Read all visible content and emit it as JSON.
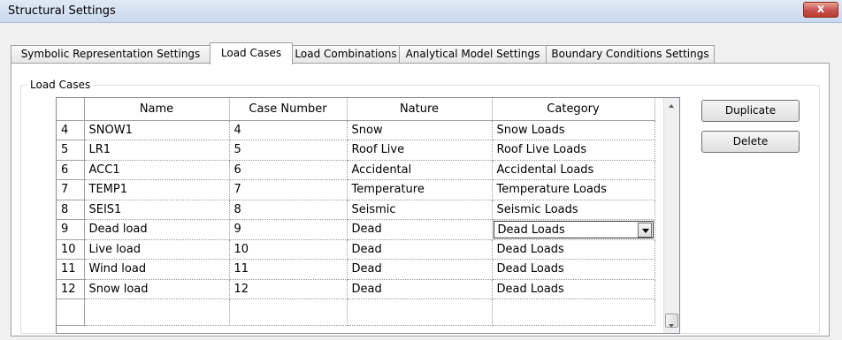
{
  "window": {
    "title": "Structural Settings",
    "close_glyph": "x"
  },
  "tabs": [
    {
      "label": "Symbolic Representation Settings",
      "active": false
    },
    {
      "label": "Load Cases",
      "active": true
    },
    {
      "label": "Load Combinations",
      "active": false
    },
    {
      "label": "Analytical Model Settings",
      "active": false
    },
    {
      "label": "Boundary Conditions Settings",
      "active": false
    }
  ],
  "load_cases": {
    "group_label": "Load Cases",
    "columns": [
      "Name",
      "Case Number",
      "Nature",
      "Category"
    ],
    "rows": [
      {
        "index": "4",
        "name": "SNOW1",
        "case_number": "4",
        "nature": "Snow",
        "category": "Snow Loads"
      },
      {
        "index": "5",
        "name": "LR1",
        "case_number": "5",
        "nature": "Roof Live",
        "category": "Roof Live Loads"
      },
      {
        "index": "6",
        "name": "ACC1",
        "case_number": "6",
        "nature": "Accidental",
        "category": "Accidental Loads"
      },
      {
        "index": "7",
        "name": "TEMP1",
        "case_number": "7",
        "nature": "Temperature",
        "category": "Temperature Loads"
      },
      {
        "index": "8",
        "name": "SEIS1",
        "case_number": "8",
        "nature": "Seismic",
        "category": "Seismic Loads"
      },
      {
        "index": "9",
        "name": "Dead load",
        "case_number": "9",
        "nature": "Dead",
        "category": "Dead Loads"
      },
      {
        "index": "10",
        "name": "Live load",
        "case_number": "10",
        "nature": "Dead",
        "category": "Dead Loads"
      },
      {
        "index": "11",
        "name": "Wind load",
        "case_number": "11",
        "nature": "Dead",
        "category": "Dead Loads"
      },
      {
        "index": "12",
        "name": "Snow load",
        "case_number": "12",
        "nature": "Dead",
        "category": "Dead Loads"
      }
    ],
    "editing_row_index": "9"
  },
  "buttons": {
    "duplicate": "Duplicate",
    "delete": "Delete"
  }
}
